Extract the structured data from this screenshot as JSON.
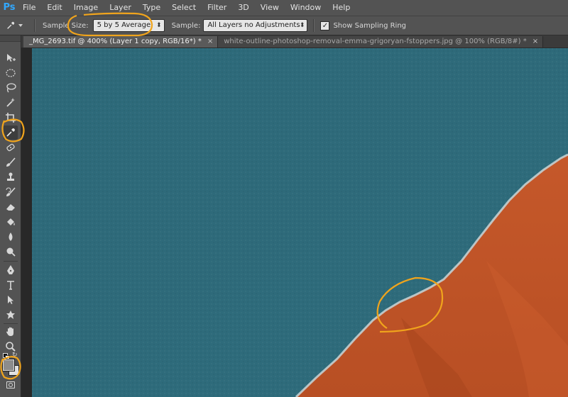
{
  "app": {
    "logo": "Ps"
  },
  "menu": [
    "File",
    "Edit",
    "Image",
    "Layer",
    "Type",
    "Select",
    "Filter",
    "3D",
    "View",
    "Window",
    "Help"
  ],
  "options": {
    "tool_icon": "eyedropper-icon",
    "sample_size_label": "Sample Size:",
    "sample_size_value": "5 by 5 Average",
    "sample_label": "Sample:",
    "sample_value": "All Layers no Adjustments",
    "show_ring_label": "Show Sampling Ring",
    "show_ring_checked": true,
    "select_arrow": "⬍",
    "check_mark": "✓"
  },
  "tabs": [
    {
      "label": "_MG_2693.tif @ 400% (Layer 1 copy, RGB/16*) *",
      "active": true
    },
    {
      "label": "white-outline-photoshop-removal-emma-grigoryan-fstoppers.jpg @ 100% (RGB/8#) *",
      "active": false
    }
  ],
  "tab_close_glyph": "×",
  "tools": [
    "move-icon",
    "elliptical-marquee-icon",
    "lasso-icon",
    "quick-selection-icon",
    "crop-icon",
    "eyedropper-icon",
    "spot-healing-icon",
    "brush-icon",
    "clone-stamp-icon",
    "history-brush-icon",
    "eraser-icon",
    "paint-bucket-icon",
    "blur-icon",
    "dodge-icon",
    "pen-icon",
    "type-icon",
    "path-selection-icon",
    "custom-shape-icon",
    "hand-icon",
    "zoom-icon"
  ],
  "colors": {
    "background_teal": "#2f6b7a",
    "subject_orange": "#c8592a",
    "fringe_white": "#c9d6d8",
    "annotation_orange": "#f0a41c",
    "foreground_swatch": "#8c8c8c",
    "background_swatch": "#e0e0e0"
  }
}
